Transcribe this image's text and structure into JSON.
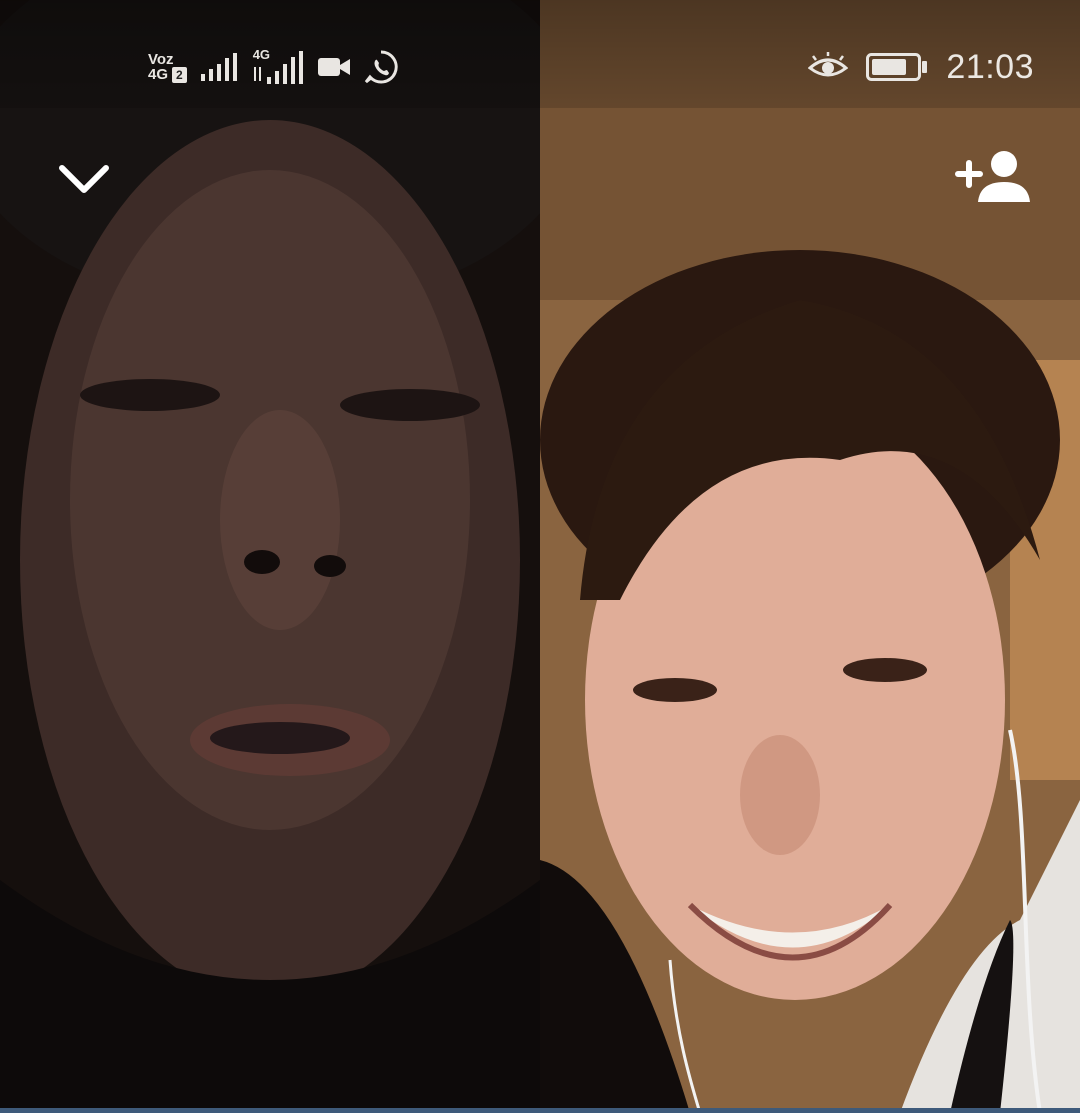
{
  "status_bar": {
    "carrier_line1": "Voz",
    "carrier_line2": "4G",
    "sim_badge": "2",
    "network_label": "4G",
    "time": "21:03",
    "icons": [
      "signal-bars-icon",
      "signal-4g-icon",
      "video-camera-icon",
      "whatsapp-icon",
      "eye-comfort-icon",
      "battery-icon"
    ],
    "battery_level": 0.8
  },
  "call": {
    "controls": {
      "collapse_icon": "chevron-down-icon",
      "add_participant_icon": "add-person-icon"
    },
    "participants": [
      {
        "position": "left",
        "feed": "remote-video"
      },
      {
        "position": "right",
        "feed": "remote-video"
      }
    ]
  },
  "colors": {
    "icon_white": "#ffffff",
    "status_text": "#ece8e3",
    "nav_accent": "#3e5a7a"
  }
}
